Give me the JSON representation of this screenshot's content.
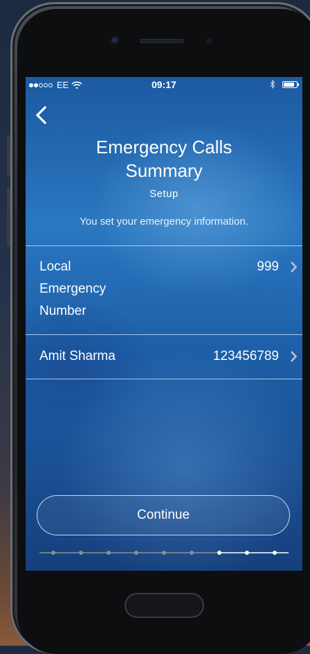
{
  "status_bar": {
    "carrier": "EE",
    "time": "09:17",
    "signal_strength": 2,
    "signal_max": 5,
    "battery_level": 0.85,
    "icons": [
      "wifi-icon",
      "bluetooth-icon",
      "battery-icon"
    ]
  },
  "nav": {
    "back_icon": "back-chevron-icon"
  },
  "header": {
    "title_line1": "Emergency Calls",
    "title_line2": "Summary",
    "subtitle": "Setup",
    "description": "You set your emergency information."
  },
  "rows": [
    {
      "label_lines": [
        "Local",
        "Emergency",
        "Number"
      ],
      "value": "999"
    },
    {
      "label": "Amit Sharma",
      "value": "123456789"
    }
  ],
  "continue_label": "Continue",
  "progress": {
    "total_steps": 9,
    "completed_steps": 7
  },
  "colors": {
    "screen_blue": "#1d5fa8",
    "text": "#ffffff",
    "progress_done": "#8a8f96",
    "progress_current": "#ffffff"
  }
}
